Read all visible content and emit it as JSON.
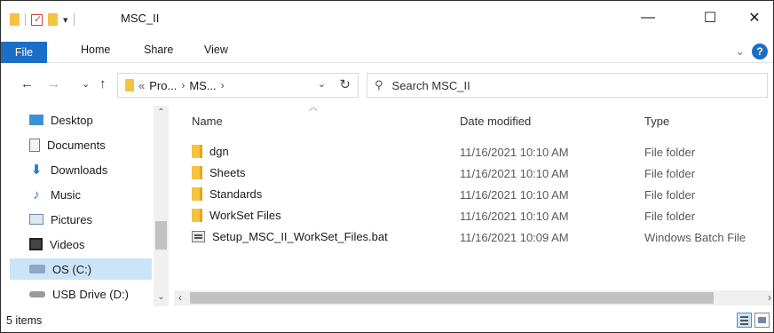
{
  "window": {
    "title": "MSC_II",
    "minimize_glyph": "—",
    "maximize_glyph": "☐",
    "close_glyph": "✕"
  },
  "ribbon": {
    "tabs": [
      "File",
      "Home",
      "Share",
      "View"
    ],
    "expand_glyph": "⌄",
    "help_glyph": "?"
  },
  "address": {
    "back_glyph": "←",
    "forward_glyph": "→",
    "recent_glyph": "⌄",
    "up_glyph": "↑",
    "overflow": "«",
    "crumbs": [
      "Pro...",
      "MS..."
    ],
    "refresh_glyph": "↻",
    "dropdown_glyph": "⌄",
    "search_placeholder": "Search MSC_II"
  },
  "nav_pane": {
    "items": [
      {
        "label": "Desktop",
        "icon": "desktop-icon"
      },
      {
        "label": "Documents",
        "icon": "documents-icon"
      },
      {
        "label": "Downloads",
        "icon": "downloads-icon"
      },
      {
        "label": "Music",
        "icon": "music-icon"
      },
      {
        "label": "Pictures",
        "icon": "pictures-icon"
      },
      {
        "label": "Videos",
        "icon": "videos-icon"
      },
      {
        "label": "OS (C:)",
        "icon": "drive-icon",
        "selected": true
      },
      {
        "label": "USB Drive (D:)",
        "icon": "usb-drive-icon"
      }
    ]
  },
  "content": {
    "columns": {
      "name": "Name",
      "date": "Date modified",
      "type": "Type"
    },
    "sorted_by": "Name",
    "rows": [
      {
        "name": "dgn",
        "date": "11/16/2021 10:10 AM",
        "type": "File folder",
        "icon": "folder-icon"
      },
      {
        "name": "Sheets",
        "date": "11/16/2021 10:10 AM",
        "type": "File folder",
        "icon": "folder-icon"
      },
      {
        "name": "Standards",
        "date": "11/16/2021 10:10 AM",
        "type": "File folder",
        "icon": "folder-icon"
      },
      {
        "name": "WorkSet Files",
        "date": "11/16/2021 10:10 AM",
        "type": "File folder",
        "icon": "folder-icon"
      },
      {
        "name": "Setup_MSC_II_WorkSet_Files.bat",
        "date": "11/16/2021 10:09 AM",
        "type": "Windows Batch File",
        "icon": "batch-file-icon"
      }
    ]
  },
  "status": {
    "item_count": "5 items",
    "active_view": "details"
  },
  "colors": {
    "accent": "#1a6fc4",
    "selection": "#cce4f7",
    "folder": "#f5c242"
  }
}
